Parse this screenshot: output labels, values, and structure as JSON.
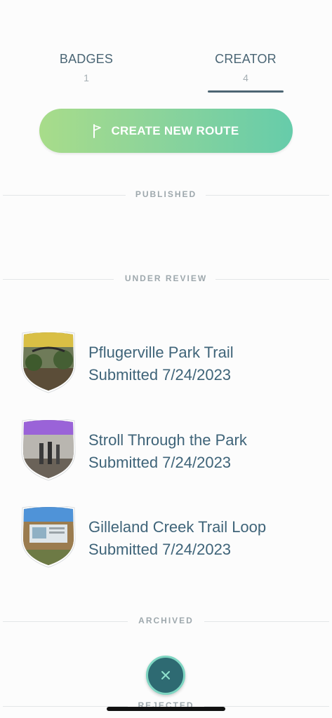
{
  "tabs": [
    {
      "label": "BADGES",
      "count": "1"
    },
    {
      "label": "CREATOR",
      "count": "4"
    }
  ],
  "create_button": {
    "label": "CREATE NEW ROUTE",
    "icon": "flag-icon"
  },
  "sections": {
    "published": "PUBLISHED",
    "under_review": "UNDER REVIEW",
    "archived": "ARCHIVED",
    "rejected": "REJECTED"
  },
  "routes": [
    {
      "name": "Pflugerville Park Trail",
      "status": "Submitted 7/24/2023",
      "banner_color": "#d9bf45"
    },
    {
      "name": "Stroll Through the Park",
      "status": "Submitted 7/24/2023",
      "banner_color": "#9a63d8"
    },
    {
      "name": "Gilleland Creek Trail Loop",
      "status": "Submitted 7/24/2023",
      "banner_color": "#4f93d8"
    }
  ],
  "close_button": {
    "icon": "close-icon"
  },
  "colors": {
    "accent": "#4d6573",
    "text": "#3f6479",
    "fab": "#2e6a72"
  }
}
